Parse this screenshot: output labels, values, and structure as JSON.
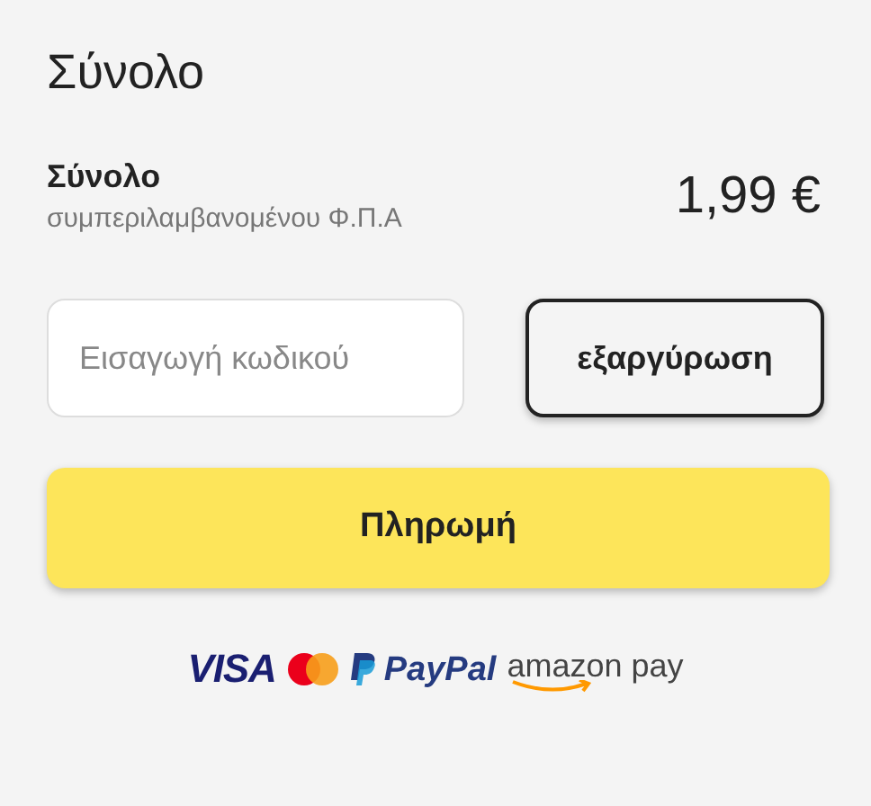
{
  "title": "Σύνολο",
  "summary": {
    "label": "Σύνολο",
    "note": "συμπεριλαμβανομένου Φ.Π.Α",
    "price": "1,99 €"
  },
  "coupon": {
    "placeholder": "Εισαγωγή κωδικού",
    "button": "εξαργύρωση"
  },
  "pay_button": "Πληρωμή",
  "payment_logos": [
    {
      "kind": "visa",
      "text": "VISA"
    },
    {
      "kind": "mastercard"
    },
    {
      "kind": "paypal",
      "text": "PayPal"
    },
    {
      "kind": "amazon",
      "text": "amazon pay"
    }
  ]
}
